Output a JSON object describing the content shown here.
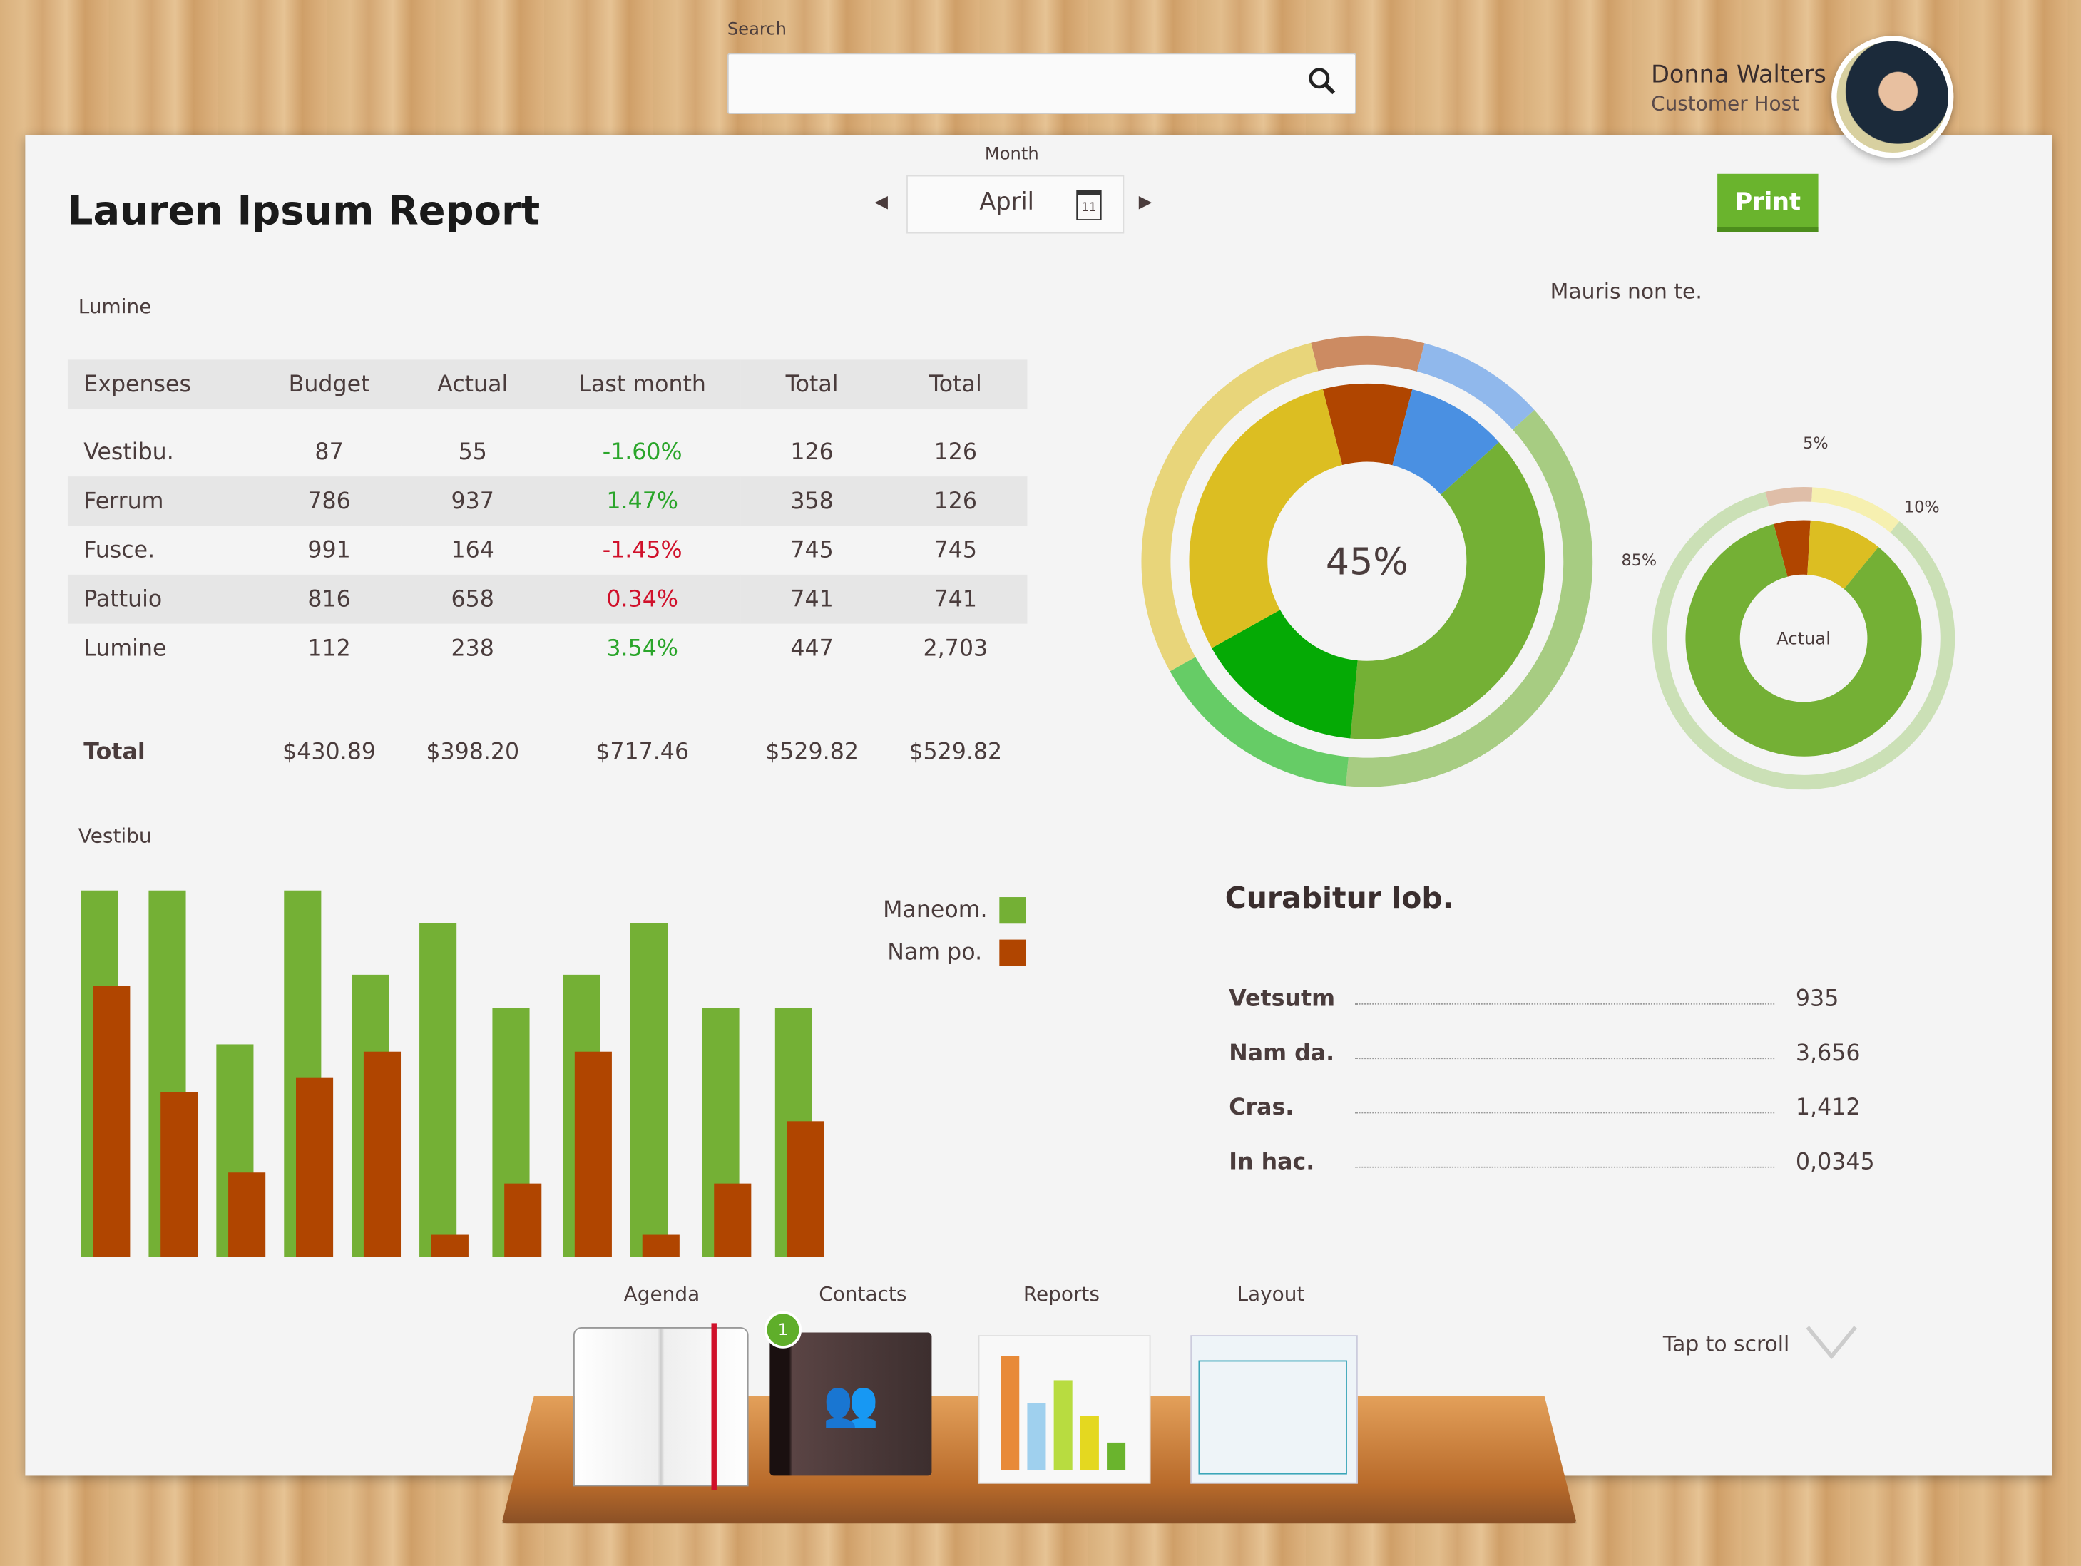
{
  "header": {
    "search_label": "Search",
    "search_value": "",
    "search_placeholder": "",
    "user_name": "Donna Walters",
    "user_role": "Customer Host"
  },
  "report": {
    "title": "Lauren Ipsum Report",
    "month_label": "Month",
    "month_value": "April",
    "calendar_day": "11",
    "print_label": "Print"
  },
  "table": {
    "caption": "Lumine",
    "columns": [
      "Expenses",
      "Budget",
      "Actual",
      "Last month",
      "Total",
      "Total"
    ],
    "rows": [
      {
        "cells": [
          "Vestibu.",
          "87",
          "55",
          "-1.60%",
          "126",
          "126"
        ],
        "trend": "pos"
      },
      {
        "cells": [
          "Ferrum",
          "786",
          "937",
          "1.47%",
          "358",
          "126"
        ],
        "trend": "pos"
      },
      {
        "cells": [
          "Fusce.",
          "991",
          "164",
          "-1.45%",
          "745",
          "745"
        ],
        "trend": "neg"
      },
      {
        "cells": [
          "Pattuio",
          "816",
          "658",
          "0.34%",
          "741",
          "741"
        ],
        "trend": "neg"
      },
      {
        "cells": [
          "Lumine",
          "112",
          "238",
          "3.54%",
          "447",
          "2,703"
        ],
        "trend": "pos"
      }
    ],
    "total": [
      "Total",
      "$430.89",
      "$398.20",
      "$717.46",
      "$529.82",
      "$529.82"
    ]
  },
  "chart_data": [
    {
      "type": "pie",
      "title": "Mauris non te.",
      "center_label": "45%",
      "segments": [
        {
          "value": 8.1,
          "color": "#b04500",
          "outer_color": "#cc8b62"
        },
        {
          "value": 9.2,
          "color": "#4a90e2",
          "outer_color": "#90b8ec"
        },
        {
          "value": 38.2,
          "color": "#74b035",
          "outer_color": "#a7cc82"
        },
        {
          "value": 15.4,
          "color": "#05aa05",
          "outer_color": "#66cc66"
        },
        {
          "value": 29.1,
          "color": "#dcbe22",
          "outer_color": "#e8d57a"
        }
      ]
    },
    {
      "type": "pie",
      "center_label": "Actual",
      "segments": [
        {
          "label": "5%",
          "value": 5,
          "color": "#b04500",
          "outer_color": "#dfbea8"
        },
        {
          "label": "10%",
          "value": 10,
          "color": "#dcbe22",
          "outer_color": "#f6f0b0"
        },
        {
          "label": "85%",
          "value": 85,
          "color": "#74b035",
          "outer_color": "#cbe0b6"
        }
      ]
    },
    {
      "type": "bar",
      "title": "Vestibu",
      "ylim": [
        0,
        100
      ],
      "series": [
        {
          "name": "Maneom.",
          "color": "#74b035",
          "values": [
            100,
            100,
            58,
            100,
            77,
            91,
            68,
            77,
            91,
            68,
            68
          ]
        },
        {
          "name": "Nam po.",
          "color": "#b04500",
          "values": [
            74,
            45,
            23,
            49,
            56,
            6,
            20,
            56,
            6,
            20,
            37
          ]
        }
      ]
    }
  ],
  "stats": {
    "title": "Curabitur lob.",
    "items": [
      {
        "label": "Vetsutm",
        "value": "935"
      },
      {
        "label": "Nam da.",
        "value": "3,656"
      },
      {
        "label": "Cras.",
        "value": "1,412"
      },
      {
        "label": "In hac.",
        "value": "0,0345"
      }
    ]
  },
  "dock": {
    "items": [
      "Agenda",
      "Contacts",
      "Reports",
      "Layout"
    ],
    "badge": "1",
    "scroll_label": "Tap to scroll"
  }
}
